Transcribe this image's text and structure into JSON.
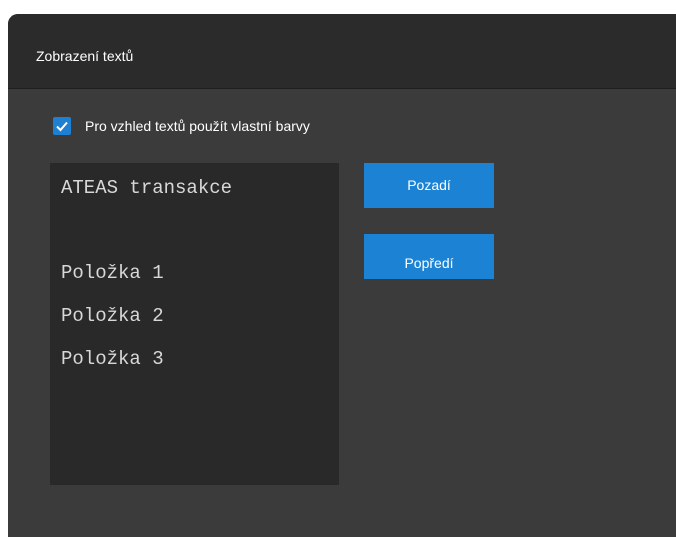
{
  "header": {
    "title": "Zobrazení textů"
  },
  "checkbox": {
    "label": "Pro vzhled textů použít vlastní barvy",
    "checked": true,
    "color": "#1f7fd1"
  },
  "preview": {
    "lines": [
      "ATEAS transakce",
      "",
      "Položka 1",
      "Položka 2",
      "Položka 3"
    ],
    "background": "#292929",
    "foreground": "#d8d8d8"
  },
  "buttons": {
    "background_label": "Pozadí",
    "foreground_label": "Popředí",
    "color": "#1c83d4"
  }
}
